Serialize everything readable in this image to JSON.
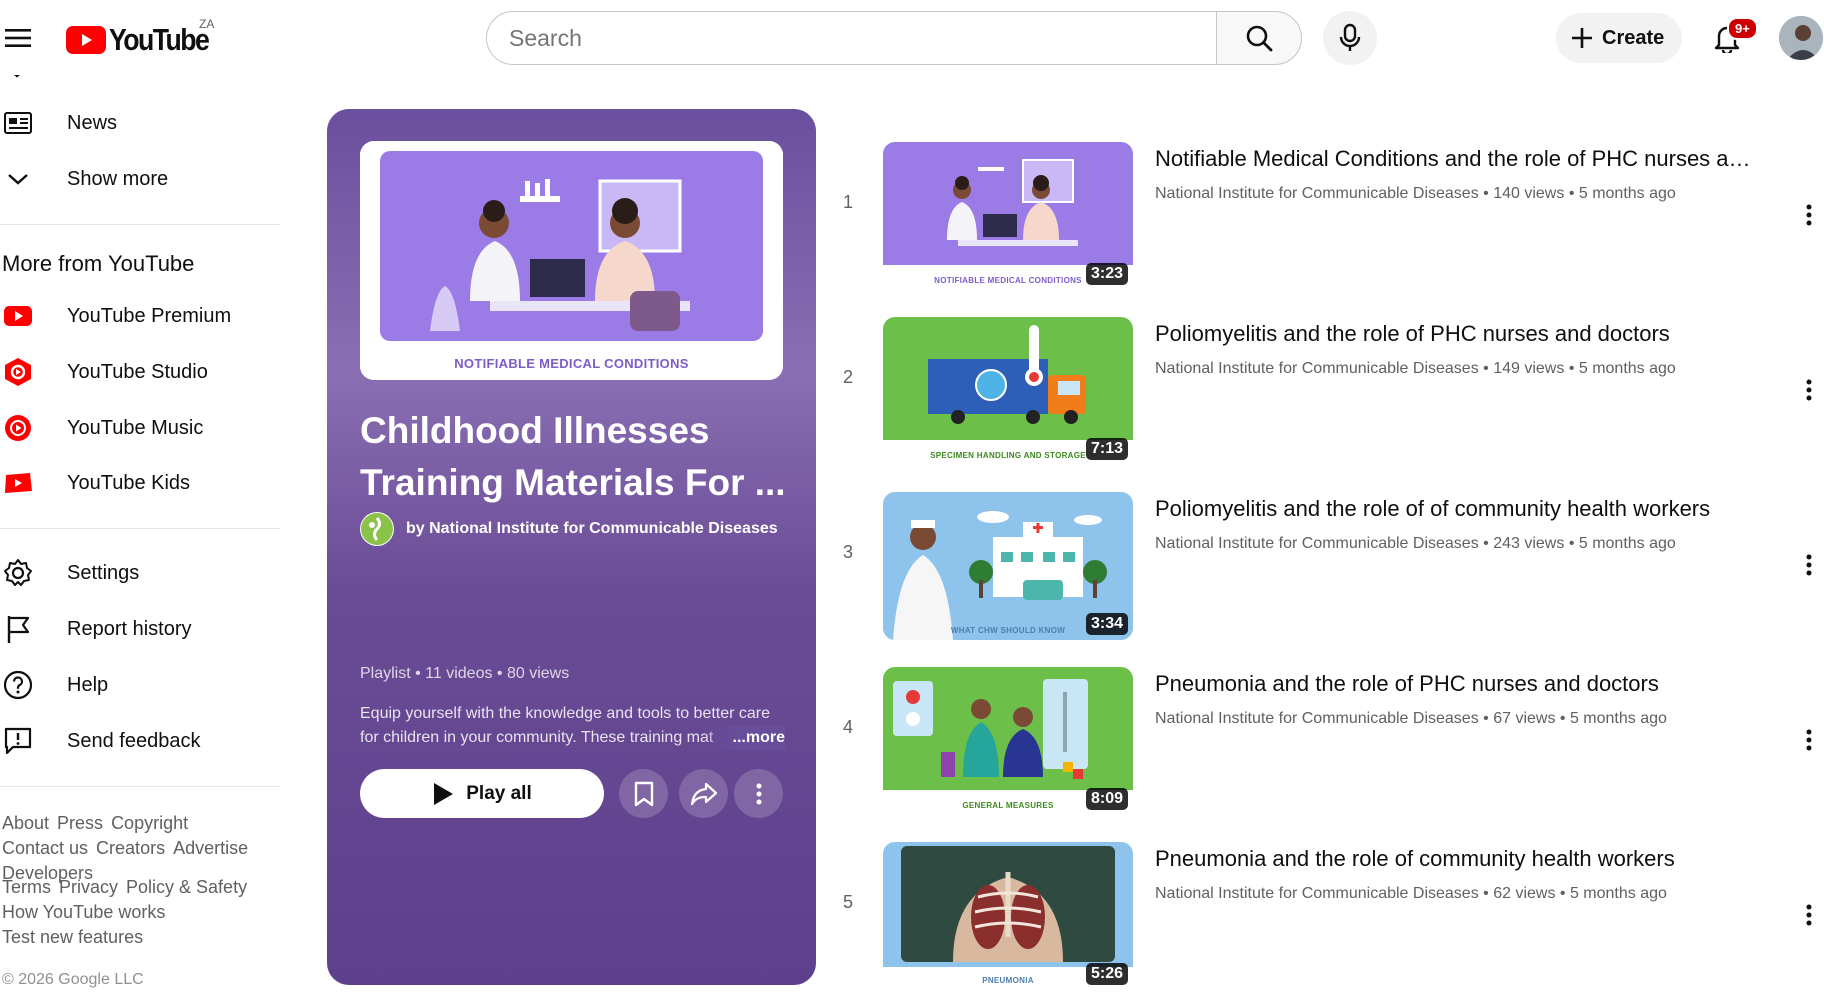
{
  "header": {
    "logo_text": "YouTube",
    "region": "ZA",
    "search_placeholder": "Search",
    "create_label": "Create",
    "notification_count": "9+"
  },
  "sidebar": {
    "top_items": [
      {
        "label": "News",
        "icon": "news-icon"
      },
      {
        "label": "Show more",
        "icon": "chevron-down-icon"
      }
    ],
    "more_heading": "More from YouTube",
    "more_items": [
      {
        "label": "YouTube Premium",
        "icon": "youtube-premium-icon"
      },
      {
        "label": "YouTube Studio",
        "icon": "youtube-studio-icon"
      },
      {
        "label": "YouTube Music",
        "icon": "youtube-music-icon"
      },
      {
        "label": "YouTube Kids",
        "icon": "youtube-kids-icon"
      }
    ],
    "settings_items": [
      {
        "label": "Settings",
        "icon": "gear-icon"
      },
      {
        "label": "Report history",
        "icon": "flag-icon"
      },
      {
        "label": "Help",
        "icon": "help-icon"
      },
      {
        "label": "Send feedback",
        "icon": "feedback-icon"
      }
    ],
    "footer_row1": [
      "About",
      "Press",
      "Copyright"
    ],
    "footer_row2": [
      "Contact us",
      "Creators",
      "Advertise"
    ],
    "footer_row3": [
      "Developers"
    ],
    "footer_row4": [
      "Terms",
      "Privacy",
      "Policy & Safety"
    ],
    "footer_row5": [
      "How YouTube works"
    ],
    "footer_row6": [
      "Test new features"
    ],
    "copyright": "© 2026 Google LLC"
  },
  "playlist": {
    "thumb_caption": "NOTIFIABLE MEDICAL CONDITIONS",
    "title_line1": "Childhood Illnesses",
    "title_line2": "Training Materials For ...",
    "channel": "by National Institute for Communicable Diseases",
    "meta": "Playlist • 11 videos • 80 views",
    "description": "Equip yourself with the knowledge and tools to better care for children in your community. These training mat",
    "more_label": "...more",
    "play_all_label": "Play all",
    "colors": {
      "panel": "#6a4f9e",
      "thumb_bg": "#9b7be6"
    }
  },
  "videos": [
    {
      "index": "1",
      "title": "Notifiable Medical Conditions and the role of PHC nurses and doctors",
      "channel": "National Institute for Communicable Diseases",
      "views": "140 views",
      "age": "5 months ago",
      "duration": "3:23",
      "caption": "NOTIFIABLE MEDICAL CONDITIONS",
      "bg": "#9b7be6",
      "cap_color": "#7b5cc9"
    },
    {
      "index": "2",
      "title": "Poliomyelitis and the role of PHC nurses and doctors",
      "channel": "National Institute for Communicable Diseases",
      "views": "149 views",
      "age": "5 months ago",
      "duration": "7:13",
      "caption": "SPECIMEN HANDLING AND STORAGE",
      "bg": "#6cc04a",
      "cap_color": "#3c8a1f"
    },
    {
      "index": "3",
      "title": "Poliomyelitis and the role of of community health workers",
      "channel": "National Institute for Communicable Diseases",
      "views": "243 views",
      "age": "5 months ago",
      "duration": "3:34",
      "caption": "WHAT CHW SHOULD KNOW",
      "bg": "#8ec3ec",
      "cap_color": "#4a7fb0"
    },
    {
      "index": "4",
      "title": "Pneumonia and the role of PHC nurses and doctors",
      "channel": "National Institute for Communicable Diseases",
      "views": "67 views",
      "age": "5 months ago",
      "duration": "8:09",
      "caption": "GENERAL MEASURES",
      "bg": "#6cc04a",
      "cap_color": "#3c8a1f"
    },
    {
      "index": "5",
      "title": "Pneumonia and the role of community health workers",
      "channel": "National Institute for Communicable Diseases",
      "views": "62 views",
      "age": "5 months ago",
      "duration": "5:26",
      "caption": "PNEUMONIA",
      "bg": "#8ec3ec",
      "cap_color": "#4a7fb0"
    }
  ]
}
